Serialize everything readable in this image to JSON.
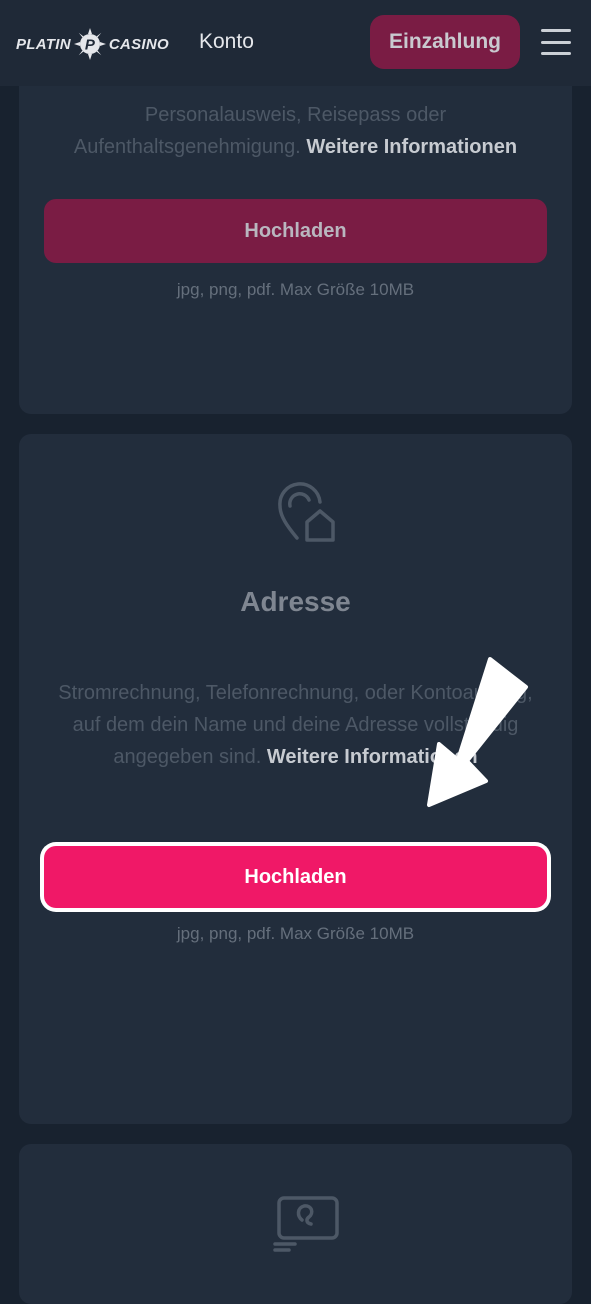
{
  "header": {
    "logo_left": "PLATIN",
    "logo_letter": "P",
    "logo_right": "CASINO",
    "nav_title": "Konto",
    "deposit_label": "Einzahlung",
    "menu_icon": "hamburger-menu-icon"
  },
  "identity_card": {
    "description": "Personalausweis, Reisepass oder Aufenthaltsgenehmigung.",
    "more_info": "Weitere Informationen",
    "upload_label": "Hochladen",
    "file_hint": "jpg, png, pdf. Max Größe 10MB"
  },
  "address_card": {
    "icon": "location-home-icon",
    "title": "Adresse",
    "description": "Stromrechnung, Telefonrechnung, oder Kontoauszug, auf dem dein Name und deine Adresse vollständig angegeben sind.",
    "more_info": "Weitere Informationen",
    "upload_label": "Hochladen",
    "file_hint": "jpg, png, pdf. Max Größe 10MB"
  },
  "payment_card": {
    "icon": "payment-card-icon"
  },
  "overlay": {
    "arrow": "pointer-arrow-icon"
  },
  "colors": {
    "background": "#18222f",
    "card": "#222d3c",
    "accent": "#f01867",
    "accent_dim": "#7a1c44"
  }
}
